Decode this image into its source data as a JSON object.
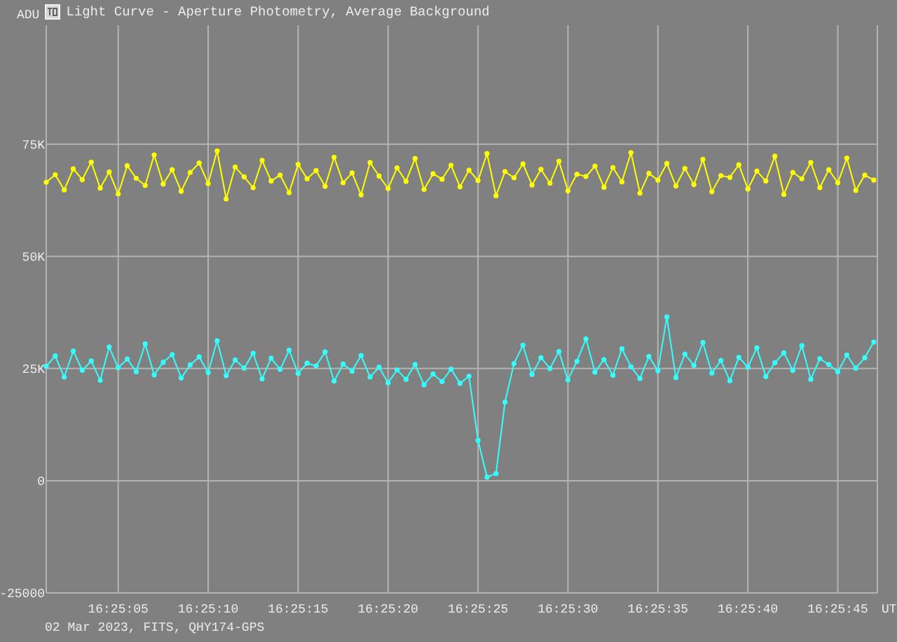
{
  "window": {
    "title": "Light Curve - Aperture Photometry, Average Background"
  },
  "chart_data": {
    "type": "line",
    "grid": true,
    "ylabel": "ADU",
    "xlabel": "UT",
    "xlim": [
      59101,
      59147.2
    ],
    "ylim": [
      -25000,
      101500
    ],
    "xticks": [
      {
        "value": 59105,
        "label": "16:25:05"
      },
      {
        "value": 59110,
        "label": "16:25:10"
      },
      {
        "value": 59115,
        "label": "16:25:15"
      },
      {
        "value": 59120,
        "label": "16:25:20"
      },
      {
        "value": 59125,
        "label": "16:25:25"
      },
      {
        "value": 59130,
        "label": "16:25:30"
      },
      {
        "value": 59135,
        "label": "16:25:35"
      },
      {
        "value": 59140,
        "label": "16:25:40"
      },
      {
        "value": 59145,
        "label": "16:25:45"
      }
    ],
    "yticks": [
      {
        "value": -25000,
        "label": "-25000"
      },
      {
        "value": 0,
        "label": "0"
      },
      {
        "value": 25000,
        "label": "25K"
      },
      {
        "value": 50000,
        "label": "50K"
      },
      {
        "value": 75000,
        "label": "75K"
      }
    ],
    "x": [
      59101,
      59101.5,
      59102,
      59102.5,
      59103,
      59103.5,
      59104,
      59104.5,
      59105,
      59105.5,
      59106,
      59106.5,
      59107,
      59107.5,
      59108,
      59108.5,
      59109,
      59109.5,
      59110,
      59110.5,
      59111,
      59111.5,
      59112,
      59112.5,
      59113,
      59113.5,
      59114,
      59114.5,
      59115,
      59115.5,
      59116,
      59116.5,
      59117,
      59117.5,
      59118,
      59118.5,
      59119,
      59119.5,
      59120,
      59120.5,
      59121,
      59121.5,
      59122,
      59122.5,
      59123,
      59123.5,
      59124,
      59124.5,
      59125,
      59125.5,
      59126,
      59126.5,
      59127,
      59127.5,
      59128,
      59128.5,
      59129,
      59129.5,
      59130,
      59130.5,
      59131,
      59131.5,
      59132,
      59132.5,
      59133,
      59133.5,
      59134,
      59134.5,
      59135,
      59135.5,
      59136,
      59136.5,
      59137,
      59137.5,
      59138,
      59138.5,
      59139,
      59139.5,
      59140,
      59140.5,
      59141,
      59141.5,
      59142,
      59142.5,
      59143,
      59143.5,
      59144,
      59144.5,
      59145,
      59145.5,
      59146,
      59146.5,
      59147
    ],
    "series": [
      {
        "color": "#ffff00",
        "marker": "circle",
        "values": [
          66500,
          68200,
          64800,
          69500,
          67100,
          71000,
          65200,
          68800,
          63900,
          70200,
          67400,
          65800,
          72600,
          66100,
          69300,
          64500,
          68700,
          70800,
          66200,
          73500,
          62800,
          69900,
          67700,
          65300,
          71400,
          66800,
          68100,
          64200,
          70500,
          67300,
          69100,
          65600,
          72100,
          66400,
          68600,
          63700,
          70900,
          67900,
          65100,
          69700,
          66700,
          71800,
          64900,
          68400,
          67200,
          70300,
          65500,
          69200,
          66900,
          72900,
          63500,
          68900,
          67500,
          70600,
          65900,
          69400,
          66300,
          71200,
          64600,
          68300,
          67800,
          70100,
          65400,
          69800,
          66600,
          73100,
          64100,
          68500,
          67000,
          70700,
          65700,
          69600,
          66000,
          71600,
          64400,
          68000,
          67600,
          70400,
          65000,
          69000,
          66800,
          72300,
          63800,
          68700,
          67300,
          70900,
          65300,
          69300,
          66400,
          71900,
          64700,
          68100,
          67000
        ]
      },
      {
        "color": "#33ffff",
        "marker": "circle",
        "values": [
          25500,
          27800,
          23100,
          28900,
          24600,
          26700,
          22400,
          29800,
          25200,
          27100,
          24300,
          30500,
          23600,
          26400,
          28100,
          22900,
          25800,
          27600,
          24100,
          31200,
          23400,
          26900,
          25100,
          28400,
          22700,
          27300,
          24800,
          29100,
          23900,
          26200,
          25600,
          28700,
          22200,
          26000,
          24400,
          27900,
          23100,
          25300,
          21800,
          24700,
          22600,
          25900,
          21400,
          23800,
          22100,
          24900,
          21700,
          23300,
          9000,
          800,
          1600,
          17500,
          26100,
          30200,
          23700,
          27400,
          25000,
          28800,
          22500,
          26600,
          31600,
          24200,
          27000,
          23500,
          29400,
          25400,
          22800,
          27700,
          24500,
          36500,
          23000,
          28200,
          25700,
          30800,
          24000,
          26800,
          22300,
          27500,
          25300,
          29600,
          23200,
          26300,
          28500,
          24600,
          30100,
          22600,
          27200,
          25900,
          24300,
          28000,
          25100,
          27400,
          30900
        ]
      }
    ]
  },
  "footer": "02 Mar 2023, FITS, QHY174-GPS"
}
